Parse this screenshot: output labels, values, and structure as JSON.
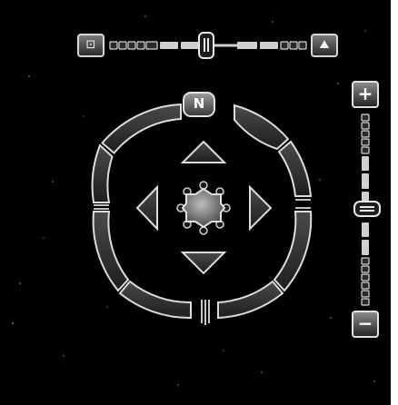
{
  "controls": {
    "compass": {
      "north_label": "N"
    },
    "tilt": {
      "level": 0.5,
      "left_icon": "tilt-top-view-icon",
      "right_icon": "tilt-horizon-view-icon"
    },
    "zoom": {
      "in_label": "+",
      "out_label": "−",
      "level": 0.5
    }
  },
  "colors": {
    "background": "#000000",
    "control_stroke": "#d8d8d8",
    "control_fill": "#3a3a3a"
  }
}
